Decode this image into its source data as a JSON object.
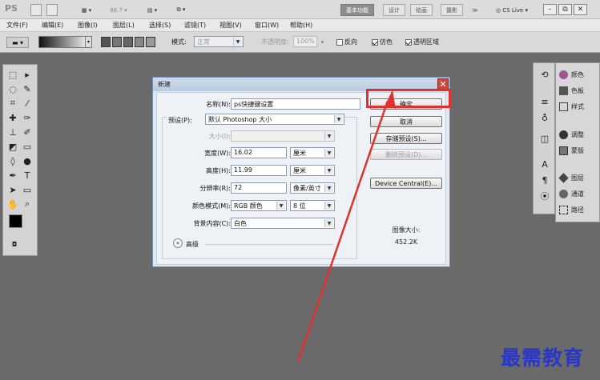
{
  "titlebar": {
    "logo": "PS",
    "zoom": "66.7",
    "workspaces": [
      "基本功能",
      "设计",
      "绘画",
      "摄影"
    ],
    "more": "≫",
    "cslive": "CS Live"
  },
  "menubar": {
    "items": [
      "文件(F)",
      "编辑(E)",
      "图像(I)",
      "图层(L)",
      "选择(S)",
      "滤镜(T)",
      "视图(V)",
      "窗口(W)",
      "帮助(H)"
    ]
  },
  "optionsbar": {
    "mode_label": "模式:",
    "mode_value": "正常",
    "opacity_label": "不透明度:",
    "opacity_value": "100%",
    "reverse_label": "反向",
    "dither_label": "仿色",
    "transparency_label": "透明区域",
    "reverse_checked": false,
    "dither_checked": true,
    "transparency_checked": true
  },
  "right_panel": {
    "items": [
      "颜色",
      "色板",
      "样式",
      "调整",
      "蒙版",
      "图层",
      "通道",
      "路径"
    ]
  },
  "dialog": {
    "title": "新建",
    "close": "✕",
    "name_label": "名称(N):",
    "name_value": "ps快捷键设置",
    "preset_label": "预设(P):",
    "preset_value": "默认 Photoshop 大小",
    "size_label": "大小(I):",
    "width_label": "宽度(W):",
    "width_value": "16.02",
    "width_unit": "厘米",
    "height_label": "高度(H):",
    "height_value": "11.99",
    "height_unit": "厘米",
    "resolution_label": "分辨率(R):",
    "resolution_value": "72",
    "resolution_unit": "像素/英寸",
    "colormode_label": "颜色模式(M):",
    "colormode_value": "RGB 颜色",
    "colordepth_value": "8 位",
    "background_label": "背景内容(C):",
    "background_value": "白色",
    "advanced_label": "高级",
    "ok_label": "确定",
    "cancel_label": "取消",
    "save_preset_label": "存储预设(S)...",
    "delete_preset_label": "删除预设(D)...",
    "device_central_label": "Device Central(E)...",
    "image_size_label": "图像大小:",
    "image_size_value": "452.2K"
  },
  "watermark": "最需教育",
  "colors": {
    "highlight_red": "#e03131",
    "watermark_blue": "#2a36c8"
  }
}
